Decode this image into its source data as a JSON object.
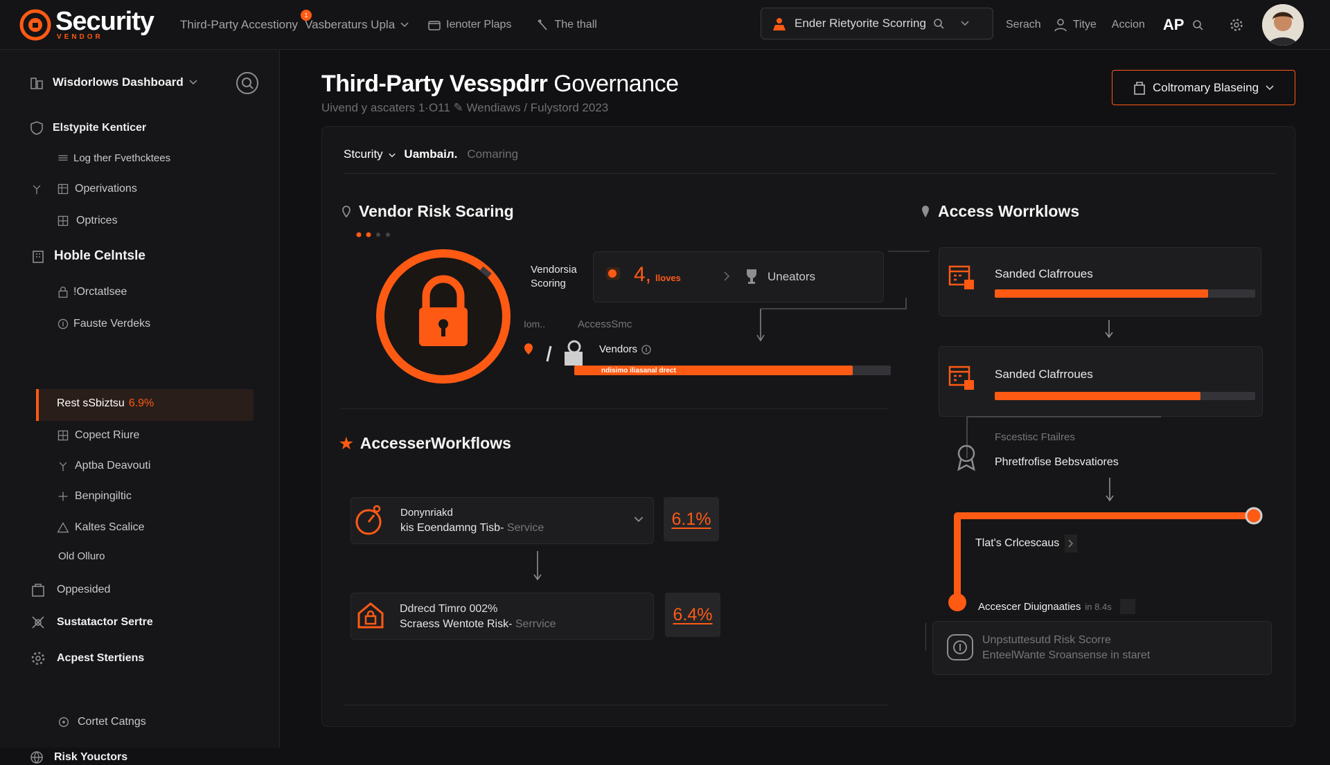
{
  "app": {
    "brand": "Security",
    "brand_sub": "VENDOR",
    "notification_count": "1"
  },
  "topnav": {
    "item1": "Third-Party Accestiony",
    "item2": "Vasberaturs Uplа",
    "item3": "Ienoter Plaps",
    "item4": "The thall",
    "search_text": "Ender Rietyorite Scorring",
    "search": "Serach",
    "type": "Titye",
    "action": "Accion",
    "ai_badge": "AP"
  },
  "sidebar": {
    "dashboard": "Wisdorlows Dashboard",
    "section1": "Elstypite Kenticer",
    "item_log": "Log ther Fvethcktees",
    "item_ops": "Operivations",
    "item_opt": "Optrices",
    "section2": "Hoble Celntsle",
    "item_orct": "!Orctatlsee",
    "item_faste": "Fauste Verdeks",
    "active_label": "Rest sSbiztsu",
    "active_value": "6.9%",
    "item_copect": "Copect Riure",
    "item_aptba": "Aptba Deavouti",
    "item_benp": "Benpingiltic",
    "item_kaltes": "Kaltes Scalice",
    "item_old": "Old Olluro",
    "item_opp": "Oppesided",
    "item_sust": "Sustatactor Sertre",
    "item_apest": "Acpest Stertiens",
    "item_cortet": "Cortet Catngs",
    "item_risk": "Risk Youctors"
  },
  "header": {
    "title_bold": "Third-Party Vesspdrr",
    "title_light": "Governance",
    "subtitle": "Uivend y ascaters 1·O11 ✎ Wendiaws / Fulystord 2023",
    "button": "Coltromary Blaseing"
  },
  "tabs": {
    "tab1": "Stcurity",
    "tab2": "Uambaiл.",
    "tab3": "Comaring"
  },
  "risk": {
    "title": "Vendor Risk Scaring",
    "vendor_label_1": "Vendorsia",
    "vendor_label_2": "Scoring",
    "score": "4,",
    "score_unit": "llovеs",
    "uneators": "Uneators",
    "iom": "Iom..",
    "access_label": "AccessSmc",
    "vendors": "Vendors",
    "bar_label": "ndisimo iliasanal drect",
    "bar_progress": 0.88
  },
  "workflows": {
    "title": "AccesserWorkflows",
    "items": [
      {
        "title": "Donynriakd",
        "desc": "kis Eoendamng Tisb-",
        "service": "Service",
        "value": "6.1%"
      },
      {
        "title": "Ddreсd Timro 002%",
        "desc": "Scraess Wentote Risk-",
        "service": "Serrvice",
        "value": "6.4%"
      }
    ]
  },
  "access": {
    "title": "Access Worrklows",
    "card1": {
      "label": "Sanded Clafrroues",
      "progress": 0.82
    },
    "card2": {
      "label": "Sanded Clafrroues",
      "progress": 0.79
    },
    "faestic_label": "Fscestisc Ftailres",
    "faestic_value": "Phretfrofise Bebsvatiores",
    "tlats": "Tlat's Crlcescaus",
    "diagnostics": "Accescer Diuignaaties",
    "diagnostics_time": "in 8.4s",
    "bottom_line1": "Unpstutteѕutd Risk Scorre",
    "bottom_line2": "EnteelWante Sroansense  in starеt"
  },
  "colors": {
    "accent": "#ff5a14",
    "bg": "#111113",
    "panel": "#161618"
  }
}
